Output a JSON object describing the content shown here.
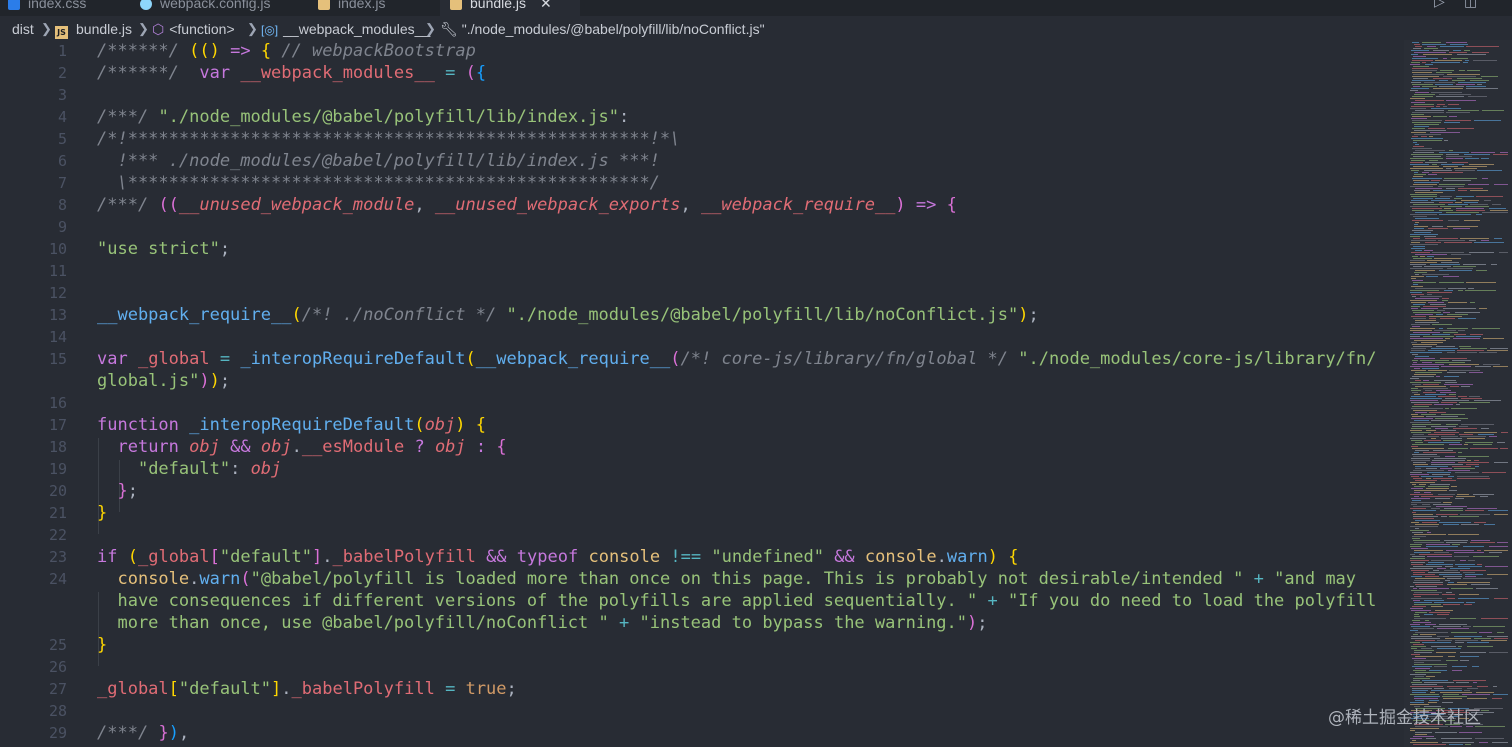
{
  "tabs": [
    {
      "label": "index.css",
      "icon": "css-file-icon"
    },
    {
      "label": "webpack.config.js",
      "icon": "webpack-config-icon"
    },
    {
      "label": "index.js",
      "icon": "js-file-icon"
    },
    {
      "label": "bundle.js",
      "icon": "js-file-icon",
      "active": true
    }
  ],
  "breadcrumb": {
    "folder": "dist",
    "file": "bundle.js",
    "file_icon": "JS",
    "symbol_function": "<function>",
    "symbol_modules": "__webpack_modules__",
    "symbol_key": "\"./node_modules/@babel/polyfill/lib/noConflict.js\""
  },
  "editor": {
    "line_numbers": [
      "1",
      "2",
      "3",
      "4",
      "5",
      "6",
      "7",
      "8",
      "9",
      "10",
      "11",
      "12",
      "13",
      "14",
      "15",
      "16",
      "17",
      "18",
      "19",
      "20",
      "21",
      "22",
      "23",
      "24",
      "25",
      "26",
      "27",
      "28",
      "29"
    ],
    "lines": [
      "/******/ (() => { // webpackBootstrap",
      "/******/  var __webpack_modules__ = ({",
      "",
      "/***/ \"./node_modules/@babel/polyfill/lib/index.js\":",
      "/*!***************************************************!*\\",
      "  !*** ./node_modules/@babel/polyfill/lib/index.js ***!",
      "  \\***************************************************/",
      "/***/ ((__unused_webpack_module, __unused_webpack_exports, __webpack_require__) => {",
      "",
      "\"use strict\";",
      "",
      "",
      "__webpack_require__(/*! ./noConflict */ \"./node_modules/@babel/polyfill/lib/noConflict.js\");",
      "",
      "var _global = _interopRequireDefault(__webpack_require__(/*! core-js/library/fn/global */ \"./node_modules/core-js/library/fn/global.js\"));",
      "",
      "function _interopRequireDefault(obj) {",
      "  return obj && obj.__esModule ? obj : {",
      "    \"default\": obj",
      "  };",
      "}",
      "",
      "if (_global[\"default\"]._babelPolyfill && typeof console !== \"undefined\" && console.warn) {",
      "  console.warn(\"@babel/polyfill is loaded more than once on this page. This is probably not desirable/intended \" + \"and may have consequences if different versions of the polyfills are applied sequentially. \" + \"If you do need to load the polyfill more than once, use @babel/polyfill/noConflict \" + \"instead to bypass the warning.\");",
      "}",
      "",
      "_global[\"default\"]._babelPolyfill = true;",
      "",
      "/***/ }),"
    ]
  },
  "watermark": "@稀土掘金技术社区",
  "colors": {
    "editor_bg": "#282c34",
    "comment": "#7f848e",
    "string": "#98c379",
    "keyword": "#c678dd",
    "function": "#61afef",
    "variable": "#e06c75",
    "class": "#e5c07b",
    "operator": "#56b6c2",
    "constant": "#d19a66"
  }
}
